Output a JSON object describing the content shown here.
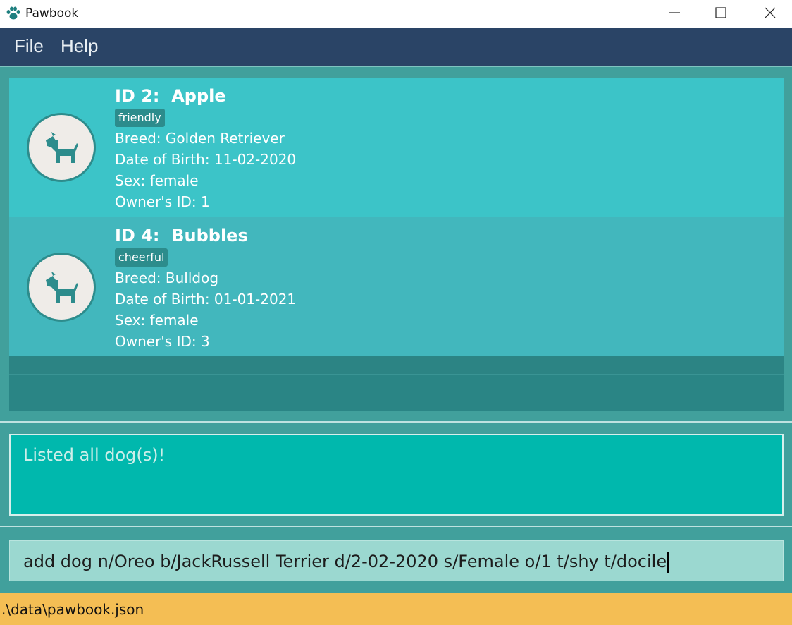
{
  "window": {
    "title": "Pawbook",
    "app_icon": "paw-icon",
    "controls": [
      "minimize-icon",
      "maximize-icon",
      "close-icon"
    ]
  },
  "menu": {
    "items": [
      {
        "label": "File"
      },
      {
        "label": "Help"
      }
    ]
  },
  "dogs": [
    {
      "title": "ID 2:  Apple",
      "tag": "friendly",
      "breed": "Breed: Golden Retriever",
      "dob": "Date of Birth: 11-02-2020",
      "sex": "Sex: female",
      "owner": "Owner's ID: 1",
      "avatar_icon": "dog-icon"
    },
    {
      "title": "ID 4:  Bubbles",
      "tag": "cheerful",
      "breed": "Breed: Bulldog",
      "dob": "Date of Birth: 01-01-2021",
      "sex": "Sex: female",
      "owner": "Owner's ID: 3",
      "avatar_icon": "dog-icon"
    }
  ],
  "result": {
    "message": "Listed all dog(s)!"
  },
  "command": {
    "value": "add dog n/Oreo b/JackRussell Terrier d/2-02-2020 s/Female o/1 t/shy t/docile"
  },
  "status": {
    "path": ".\\data\\pawbook.json"
  },
  "colors": {
    "menubar": "#2a4466",
    "background": "#41a09c",
    "selected_card": "#3cc4c8",
    "card": "#42b7bd",
    "tag": "#2c8c8c",
    "result_box": "#00b8ad",
    "command_box": "#9bd8d0",
    "statusbar": "#f4be54"
  }
}
